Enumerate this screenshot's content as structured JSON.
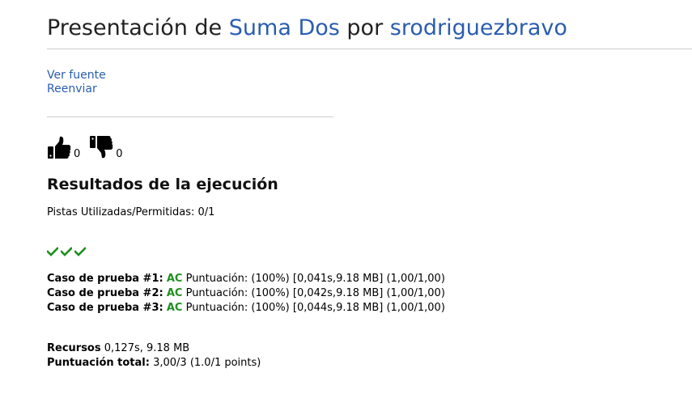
{
  "header": {
    "prefix": "Presentación de",
    "problem_name": "Suma Dos",
    "middle": "por",
    "user_name": "srodriguezbravo"
  },
  "links": {
    "view_source": "Ver fuente",
    "resubmit": "Reenviar"
  },
  "votes": {
    "up_icon": "thumbs-up-icon",
    "up_count": "0",
    "down_icon": "thumbs-down-icon",
    "down_count": "0"
  },
  "results": {
    "title": "Resultados de la ejecución",
    "hints": "Pistas Utilizadas/Permitidas: 0/1",
    "check_icon": "check-icon",
    "check_color": "#1f8f1f",
    "cases": [
      {
        "label": "Caso de prueba #1:",
        "status": "AC",
        "details": "Puntuación: (100%) [0,041s,9.18 MB] (1,00/1,00)"
      },
      {
        "label": "Caso de prueba #2:",
        "status": "AC",
        "details": "Puntuación: (100%) [0,042s,9.18 MB] (1,00/1,00)"
      },
      {
        "label": "Caso de prueba #3:",
        "status": "AC",
        "details": "Puntuación: (100%) [0,044s,9.18 MB] (1,00/1,00)"
      }
    ],
    "resources_label": "Recursos",
    "resources_value": "0,127s, 9.18 MB",
    "total_label": "Puntuación total:",
    "total_value": "3,00/3 (1.0/1 points)"
  },
  "colors": {
    "link": "#2a5db0",
    "accepted": "#1f8f1f"
  }
}
